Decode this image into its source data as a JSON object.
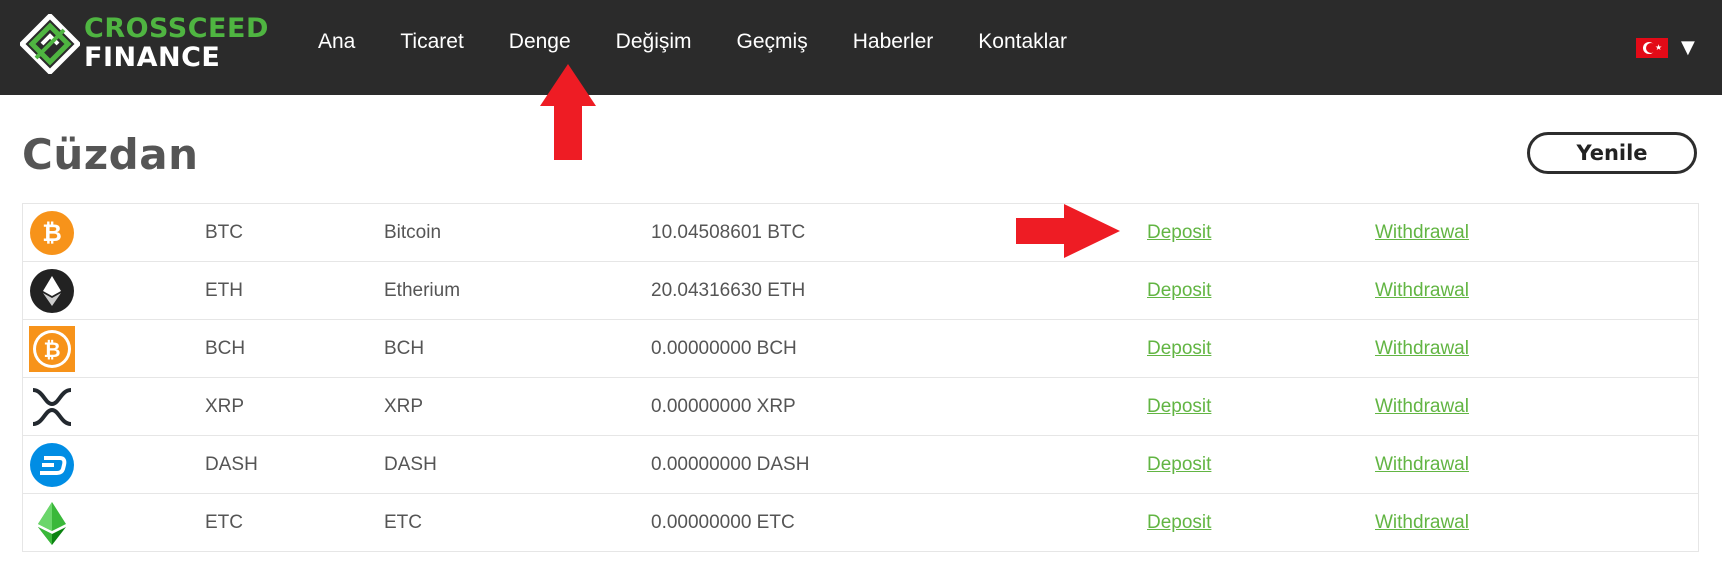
{
  "brand": {
    "line1": "CROSSCEED",
    "line2": "FINANCE",
    "accent_color": "#4fb541"
  },
  "nav": {
    "items": [
      "Ana",
      "Ticaret",
      "Denge",
      "Değişim",
      "Geçmiş",
      "Haberler",
      "Kontaklar"
    ]
  },
  "language": {
    "flag": "turkey-flag-icon",
    "caret": "▼"
  },
  "page": {
    "title": "Cüzdan",
    "refresh_label": "Yenile"
  },
  "annotation_color": "#ee1c24",
  "wallet": {
    "rows": [
      {
        "icon": "bitcoin-icon",
        "symbol": "BTC",
        "name": "Bitcoin",
        "balance": "10.04508601 BTC",
        "deposit": "Deposit",
        "withdraw": "Withdrawal"
      },
      {
        "icon": "ethereum-icon",
        "symbol": "ETH",
        "name": "Etherium",
        "balance": "20.04316630 ETH",
        "deposit": "Deposit",
        "withdraw": "Withdrawal"
      },
      {
        "icon": "bitcoin-cash-icon",
        "symbol": "BCH",
        "name": "BCH",
        "balance": "0.00000000 BCH",
        "deposit": "Deposit",
        "withdraw": "Withdrawal"
      },
      {
        "icon": "ripple-icon",
        "symbol": "XRP",
        "name": "XRP",
        "balance": "0.00000000 XRP",
        "deposit": "Deposit",
        "withdraw": "Withdrawal"
      },
      {
        "icon": "dash-icon",
        "symbol": "DASH",
        "name": "DASH",
        "balance": "0.00000000 DASH",
        "deposit": "Deposit",
        "withdraw": "Withdrawal"
      },
      {
        "icon": "ethereum-classic-icon",
        "symbol": "ETC",
        "name": "ETC",
        "balance": "0.00000000 ETC",
        "deposit": "Deposit",
        "withdraw": "Withdrawal"
      }
    ]
  }
}
